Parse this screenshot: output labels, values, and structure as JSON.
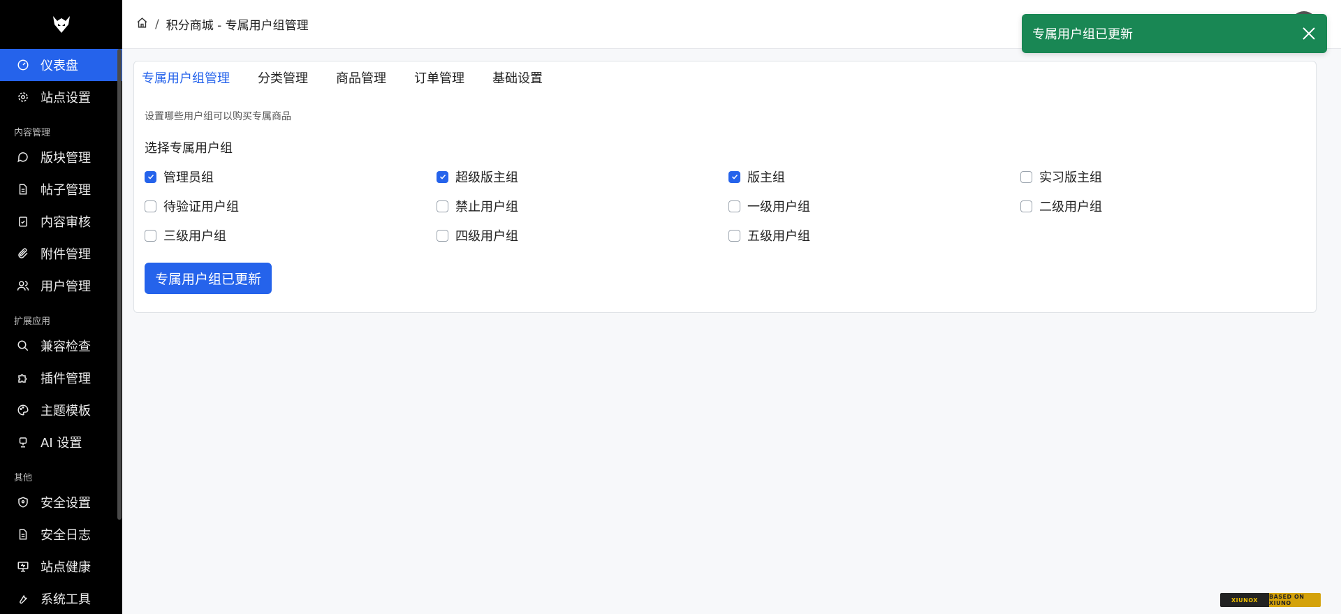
{
  "sidebar": {
    "items": [
      {
        "label": "仪表盘",
        "icon": "gauge-icon",
        "active": true
      },
      {
        "label": "站点设置",
        "icon": "gear-icon"
      }
    ],
    "sections": [
      {
        "title": "内容管理",
        "items": [
          {
            "label": "版块管理",
            "icon": "chat-icon"
          },
          {
            "label": "帖子管理",
            "icon": "file-icon"
          },
          {
            "label": "内容审核",
            "icon": "clipboard-check-icon"
          },
          {
            "label": "附件管理",
            "icon": "paperclip-icon"
          },
          {
            "label": "用户管理",
            "icon": "users-icon"
          }
        ]
      },
      {
        "title": "扩展应用",
        "items": [
          {
            "label": "兼容检查",
            "icon": "search-icon"
          },
          {
            "label": "插件管理",
            "icon": "puzzle-icon"
          },
          {
            "label": "主题模板",
            "icon": "palette-icon"
          },
          {
            "label": "AI 设置",
            "icon": "robot-icon"
          }
        ]
      },
      {
        "title": "其他",
        "items": [
          {
            "label": "安全设置",
            "icon": "shield-icon"
          },
          {
            "label": "安全日志",
            "icon": "log-icon"
          },
          {
            "label": "站点健康",
            "icon": "monitor-icon"
          },
          {
            "label": "系统工具",
            "icon": "tools-icon"
          }
        ]
      }
    ]
  },
  "header": {
    "breadcrumb": "积分商城 - 专属用户组管理",
    "separator": "/"
  },
  "tabs": [
    {
      "label": "专属用户组管理",
      "active": true
    },
    {
      "label": "分类管理"
    },
    {
      "label": "商品管理"
    },
    {
      "label": "订单管理"
    },
    {
      "label": "基础设置"
    }
  ],
  "form": {
    "description": "设置哪些用户组可以购买专属商品",
    "section_label": "选择专属用户组",
    "groups": [
      {
        "label": "管理员组",
        "checked": true
      },
      {
        "label": "超级版主组",
        "checked": true
      },
      {
        "label": "版主组",
        "checked": true
      },
      {
        "label": "实习版主组",
        "checked": false
      },
      {
        "label": "待验证用户组",
        "checked": false
      },
      {
        "label": "禁止用户组",
        "checked": false
      },
      {
        "label": "一级用户组",
        "checked": false
      },
      {
        "label": "二级用户组",
        "checked": false
      },
      {
        "label": "三级用户组",
        "checked": false
      },
      {
        "label": "四级用户组",
        "checked": false
      },
      {
        "label": "五级用户组",
        "checked": false
      }
    ],
    "submit_label": "专属用户组已更新"
  },
  "toast": {
    "message": "专属用户组已更新"
  },
  "badge": {
    "left": "XIUNOX",
    "right": "BASED ON XIUNO"
  },
  "colors": {
    "primary": "#2563eb",
    "success": "#198754",
    "sidebar_bg": "#000000"
  }
}
